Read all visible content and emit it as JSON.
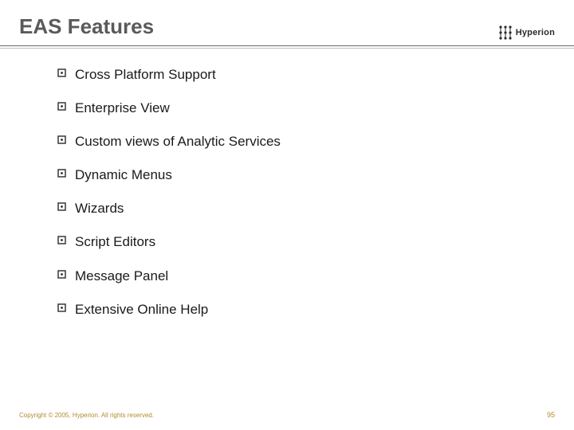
{
  "header": {
    "title": "EAS Features",
    "logo_text": "Hyperion"
  },
  "features": [
    "Cross Platform Support",
    "Enterprise View",
    "Custom views of Analytic Services",
    "Dynamic Menus",
    "Wizards",
    "Script Editors",
    "Message Panel",
    "Extensive Online Help"
  ],
  "footer": {
    "copyright": "Copyright © 2005, Hyperion. All rights reserved.",
    "page_number": "95"
  }
}
